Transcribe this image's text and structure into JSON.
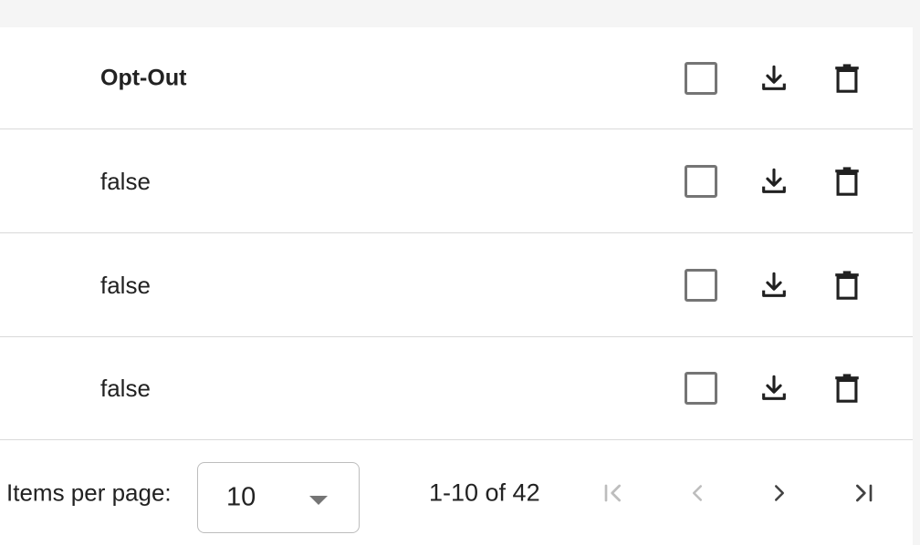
{
  "table": {
    "header": {
      "label": "Opt-Out",
      "icons": [
        "checkbox",
        "download-icon",
        "trash-icon"
      ]
    },
    "rows": [
      {
        "value": "false"
      },
      {
        "value": "false"
      },
      {
        "value": "false"
      }
    ]
  },
  "paginator": {
    "items_per_page_label": "Items per page:",
    "page_size": "10",
    "range_label": "1-10 of 42",
    "first_page_enabled": false,
    "previous_page_enabled": false,
    "next_page_enabled": true,
    "last_page_enabled": true
  },
  "colors": {
    "background": "#f5f5f5",
    "surface": "#ffffff",
    "text": "#222222",
    "icon": "#212121",
    "disabled_icon": "#bdbdbd",
    "checkbox_border": "#757575",
    "divider": "#d9d9d9"
  }
}
